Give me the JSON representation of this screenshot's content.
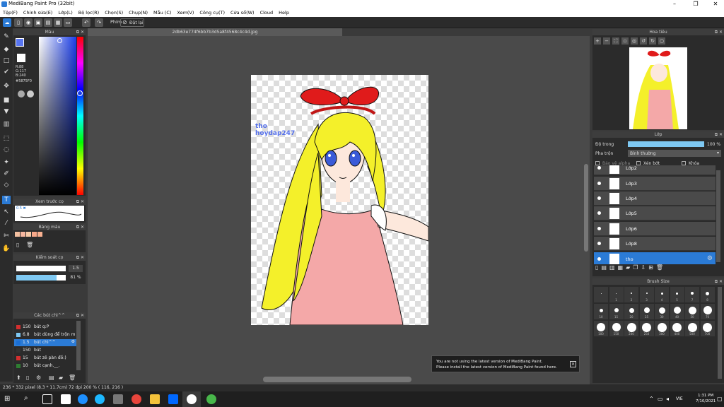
{
  "window": {
    "title": "MediBang Paint Pro (32bit)"
  },
  "menu": [
    "Tệp(F)",
    "Chỉnh sửa(E)",
    "Lớp(L)",
    "Bộ lọc(R)",
    "Chọn(S)",
    "Chụp(N)",
    "Mẫu (C)",
    "Xem(V)",
    "Công cụ(T)",
    "Cửa sổ(W)",
    "Cloud",
    "Help"
  ],
  "toolbar": {
    "pen_label": "Phím",
    "undo_label": "Đặt lại"
  },
  "color_panel": {
    "title": "Màu",
    "r": "R:88",
    "g": "G:117",
    "b": "B:240",
    "hex": "#5875F0"
  },
  "brush_preview": {
    "title": "Xem trước cọ",
    "value": "0.5 ✖"
  },
  "palette": {
    "title": "Bảng màu",
    "swatches": [
      "#f4c0a0",
      "#f7b7a0",
      "#f7caa8",
      "#f9a98a",
      "#f8b090"
    ]
  },
  "brush_control": {
    "title": "Kiểm soát cọ",
    "size": "1.5",
    "opacity": "81 %"
  },
  "brushes": {
    "title": "Các bút chì^^",
    "items": [
      {
        "size": "150",
        "name": "bút q:P",
        "color": "#d32f2f"
      },
      {
        "size": "6.8",
        "name": "bút dùng để trộn m",
        "color": "#7ec8f2"
      },
      {
        "size": "1.5",
        "name": "bút chì^^",
        "color": "#1a6fd6",
        "selected": true
      },
      {
        "size": "150",
        "name": "bút",
        "color": "#333"
      },
      {
        "size": "15",
        "name": "bút zê pàn đồ:)",
        "color": "#d32f2f"
      },
      {
        "size": "10",
        "name": "bút cạnh.__.",
        "color": "#2e7d32"
      }
    ]
  },
  "document": {
    "tab": "2db63e774f6bb7b3d5a8f4568c4c4d.jpg",
    "watermark_line1": "tho",
    "watermark_line2": "hoydap247"
  },
  "navigator": {
    "title": "Hoa tiêu"
  },
  "layers": {
    "title": "Lớp",
    "opacity_label": "Độ trong",
    "opacity_value": "100 %",
    "blend_label": "Pha trộn",
    "blend_value": "Bình thường",
    "alpha_label": "Bảo vệ alpha",
    "clip_label": "Xén bớt",
    "lock_label": "Khóa",
    "items": [
      {
        "name": "Lớp2"
      },
      {
        "name": "Lớp3"
      },
      {
        "name": "Lớp4"
      },
      {
        "name": "Lớp5"
      },
      {
        "name": "Lớp6"
      },
      {
        "name": "Lớp8"
      },
      {
        "name": "tho",
        "selected": true
      }
    ]
  },
  "brush_size": {
    "title": "Brush Size",
    "row1": [
      "",
      "1",
      "2",
      "3",
      "4",
      "5",
      "7",
      "8"
    ],
    "row2": [
      "10",
      "15",
      "20",
      "25",
      "30",
      "40",
      "50",
      "70"
    ],
    "row3": [
      "100",
      "150",
      "200",
      "250",
      "300",
      "400",
      "500",
      "700"
    ]
  },
  "notification": {
    "line1": "You are not using the latest version of MediBang Paint.",
    "line2": "Please install the latest version of MediBang Paint found here."
  },
  "status": {
    "text": "236 * 332 pixel   (8.3 * 11.7cm)   72 dpi   200 %   ( 116, 216 )"
  },
  "taskbar": {
    "time": "1:31 PM",
    "date": "7/10/2021",
    "lang": "VIE"
  },
  "colors": {
    "accent": "#2b7bd6",
    "panel": "#2b2b2b",
    "canvas_bg": "#4a4a4a"
  }
}
